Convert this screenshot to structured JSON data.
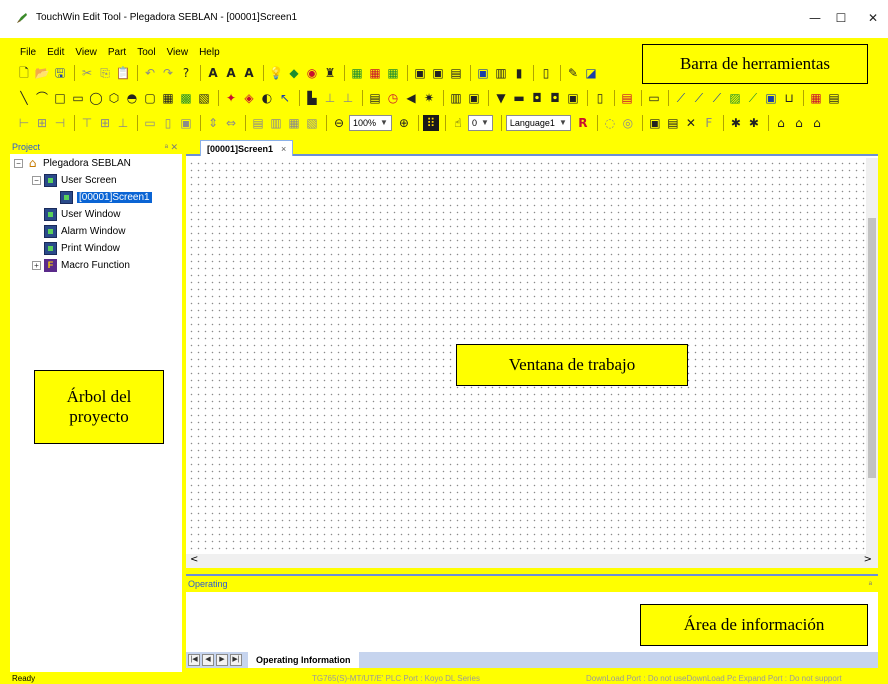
{
  "window": {
    "title": "TouchWin Edit Tool - Plegadora SEBLAN - [00001]Screen1",
    "buttons": {
      "minimize": "—",
      "maximize": "☐",
      "close": "✕"
    }
  },
  "menu": [
    "File",
    "Edit",
    "View",
    "Part",
    "Tool",
    "View",
    "Help"
  ],
  "toolbar": {
    "zoom": "100%",
    "zoom_minus": "⊖",
    "zoom_plus": "⊕",
    "layer_value": "0",
    "language": "Language1"
  },
  "callouts": {
    "toolbar": "Barra de herramientas",
    "workspace": "Ventana de trabajo",
    "project_tree_line1": "Árbol del",
    "project_tree_line2": "proyecto",
    "info_area": "Área de información"
  },
  "project_panel": {
    "title": "Project",
    "buttons": "ᵃ ✕",
    "root": "Plegadora SEBLAN",
    "nodes": [
      "User Screen",
      "[00001]Screen1",
      "User Window",
      "Alarm Window",
      "Print Window",
      "Macro Function"
    ]
  },
  "workspace": {
    "tab": "[00001]Screen1",
    "tab_close": "×",
    "scroll_left": "<",
    "scroll_right": ">"
  },
  "info": {
    "title": "Operating",
    "pin": "ᵃ",
    "tab": "Operating Information"
  },
  "status": {
    "left": "Ready",
    "plc": "TG765(S)-MT/UT/E' PLC Port : Koyo DL Series",
    "ports": "DownLoad Port : Do not useDownLoad Pc Expand Port : Do not support"
  },
  "colors": {
    "highlight": "#ffff00",
    "selection": "#0a64d4",
    "tab_accent": "#6c8fd6"
  }
}
